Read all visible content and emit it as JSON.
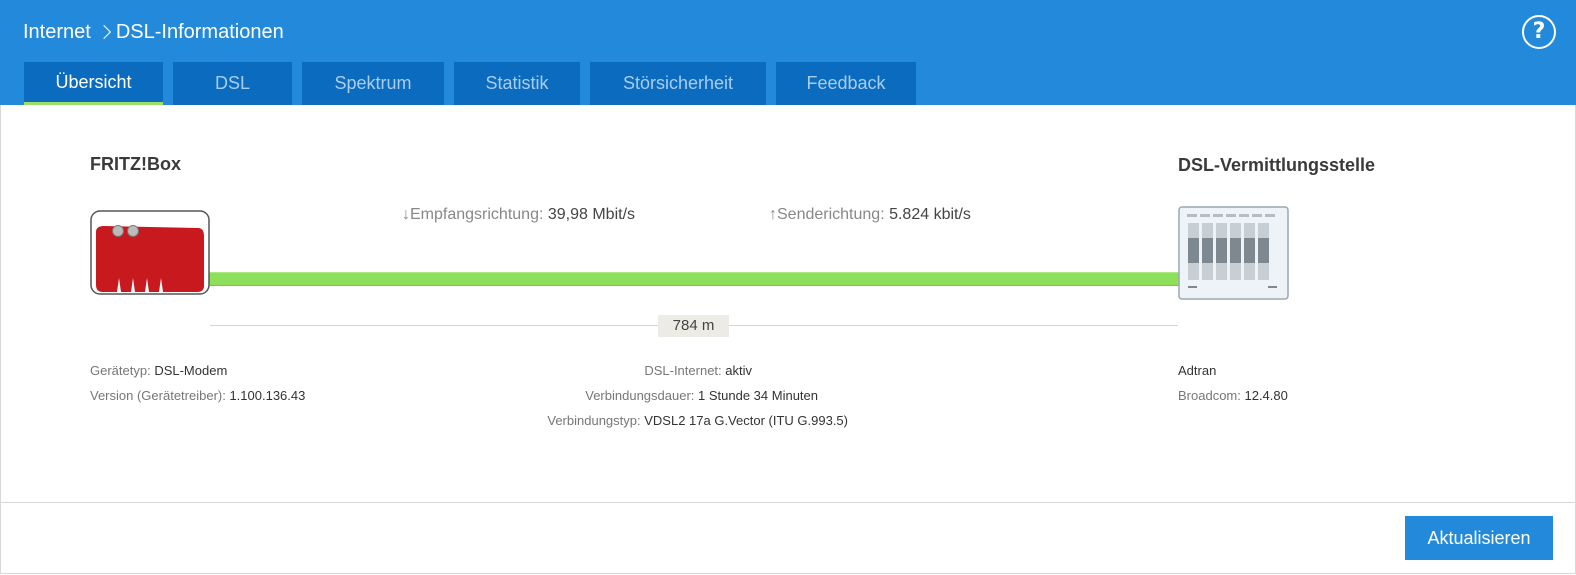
{
  "breadcrumb": {
    "parent": "Internet",
    "current": "DSL-Informationen"
  },
  "help_label": "?",
  "tabs": [
    {
      "label": "Übersicht",
      "active": true
    },
    {
      "label": "DSL"
    },
    {
      "label": "Spektrum"
    },
    {
      "label": "Statistik"
    },
    {
      "label": "Störsicherheit"
    },
    {
      "label": "Feedback"
    }
  ],
  "left": {
    "title": "FRITZ!Box",
    "fields": [
      {
        "label": "Gerätetyp: ",
        "value": "DSL-Modem"
      },
      {
        "label": "Version (Gerätetreiber): ",
        "value": "1.100.136.43"
      }
    ]
  },
  "right": {
    "title": "DSL-Vermittlungsstelle",
    "fields": [
      {
        "label": "",
        "value": "Adtran"
      },
      {
        "label": "Broadcom: ",
        "value": "12.4.80"
      }
    ]
  },
  "rates": {
    "down_label": "↓Empfangsrichtung: ",
    "down_value": "39,98 Mbit/s",
    "up_label": "↑Senderichtung: ",
    "up_value": "5.824 kbit/s"
  },
  "distance": "784 m",
  "center": {
    "fields": [
      {
        "label": "DSL-Internet: ",
        "value": "aktiv"
      },
      {
        "label": "Verbindungsdauer: ",
        "value": "1 Stunde 34 Minuten"
      },
      {
        "label": "Verbindungstyp: ",
        "value": "VDSL2 17a G.Vector (ITU G.993.5)"
      }
    ]
  },
  "refresh_button": "Aktualisieren",
  "colors": {
    "header": "#2389da",
    "tab": "#0b6bbf",
    "line": "#8ee05a",
    "router": "#c8191f"
  },
  "icons": {
    "router": "fritzbox-router-icon",
    "dslam": "dsl-exchange-icon",
    "help": "help-circle-icon"
  }
}
